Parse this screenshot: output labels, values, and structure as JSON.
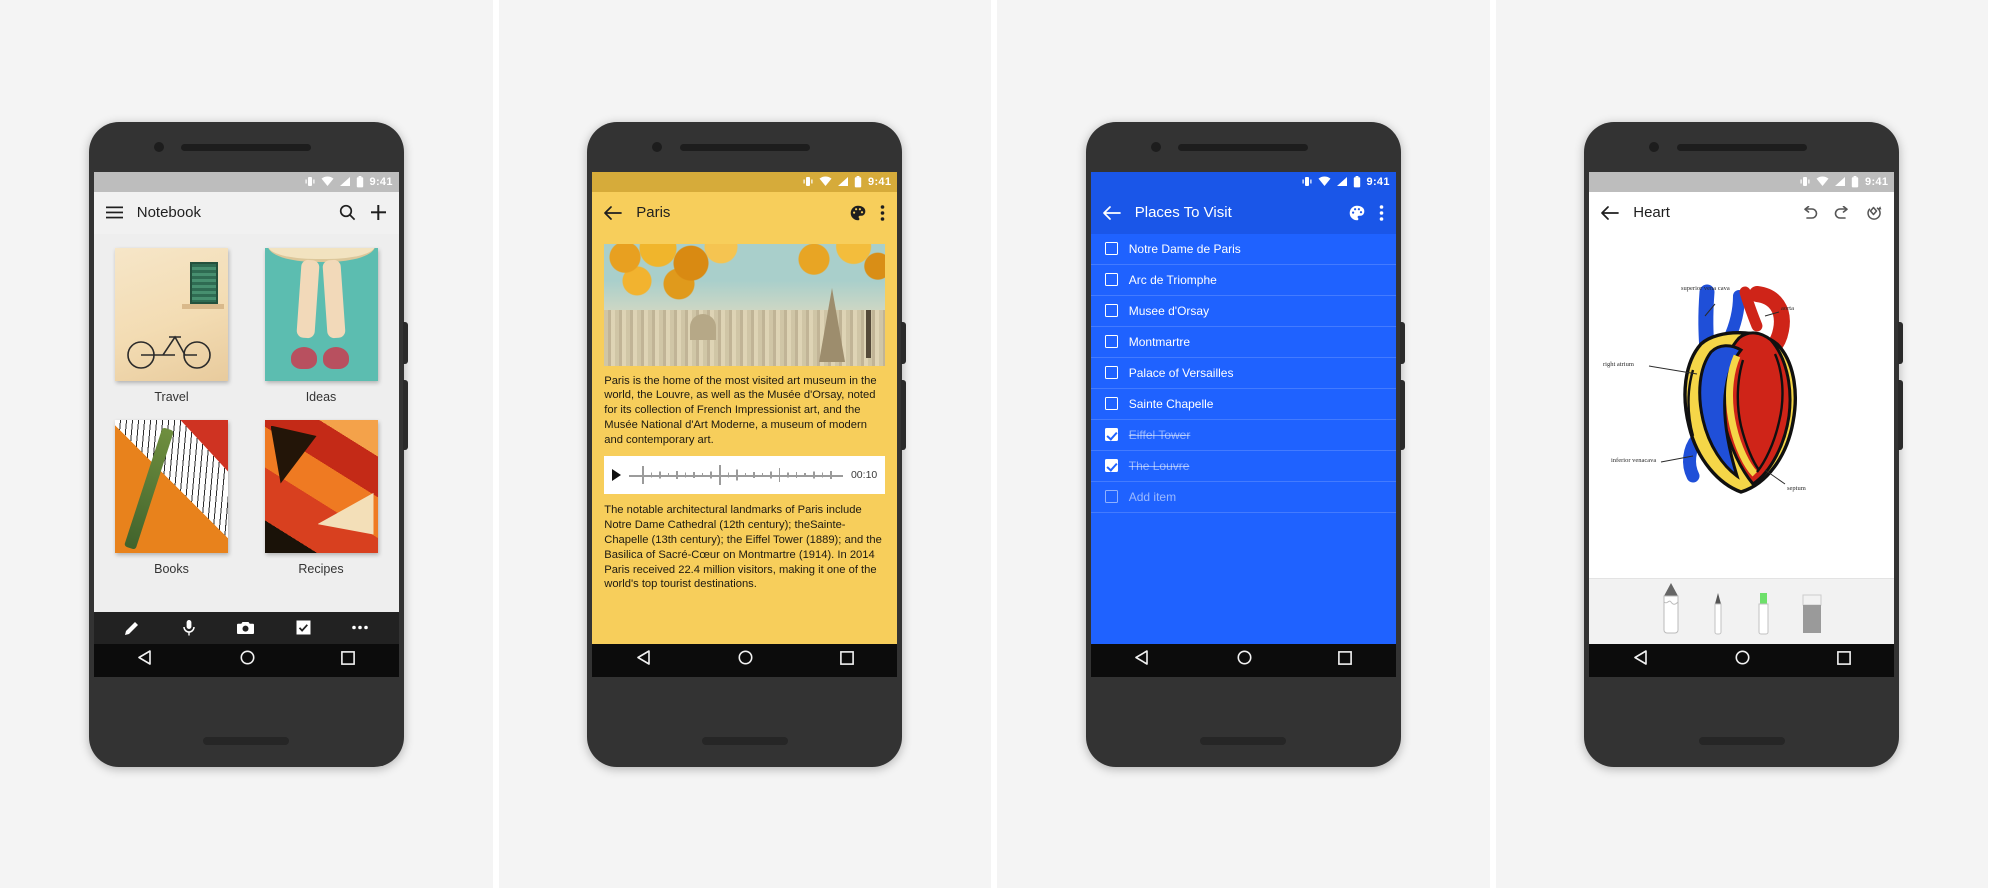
{
  "status_bar": {
    "time": "9:41",
    "icons": [
      "vibrate-icon",
      "wifi-icon",
      "signal-icon",
      "battery-icon"
    ]
  },
  "phones": [
    {
      "id": "notebook",
      "app_bar": {
        "menu_icon": "hamburger-menu-icon",
        "title": "Notebook",
        "actions": [
          "search-icon",
          "add-icon"
        ]
      },
      "notes": [
        {
          "label": "Travel",
          "thumb": "watercolor-bicycle-window"
        },
        {
          "label": "Ideas",
          "thumb": "ballet-shoes-teal"
        },
        {
          "label": "Books",
          "thumb": "orange-pattern-pen"
        },
        {
          "label": "Recipes",
          "thumb": "red-abstract-collage"
        }
      ],
      "bottom_toolbar": [
        "pen-icon",
        "microphone-icon",
        "camera-icon",
        "checklist-icon",
        "overflow-icon"
      ],
      "nav_bar": [
        "back-nav-icon",
        "home-nav-icon",
        "recents-nav-icon"
      ]
    },
    {
      "id": "paris-note",
      "app_bar": {
        "back_icon": "back-arrow-icon",
        "title": "Paris",
        "actions": [
          "palette-icon",
          "overflow-icon"
        ]
      },
      "photo_alt": "eiffel-tower-autumn-leaves-photo",
      "paragraphs": [
        "Paris is the home of the most visited art museum in the world, the Louvre, as well as the Musée d'Orsay, noted for its collection of French Impressionist art, and the Musée National d'Art Moderne, a museum of modern and contemporary art.",
        "The notable architectural landmarks of Paris include Notre Dame Cathedral (12th century); theSainte-Chapelle (13th century); the Eiffel Tower (1889); and the Basilica of Sacré-Cœur on Montmartre (1914). In 2014 Paris received 22.4 million visitors, making it one of the world's top tourist destinations."
      ],
      "audio": {
        "play_icon": "play-icon",
        "duration": "00:10"
      },
      "nav_bar": [
        "back-nav-icon",
        "home-nav-icon",
        "recents-nav-icon"
      ]
    },
    {
      "id": "places-to-visit",
      "app_bar": {
        "back_icon": "back-arrow-icon",
        "title": "Places To Visit",
        "actions": [
          "palette-icon",
          "overflow-icon"
        ]
      },
      "items": [
        {
          "label": "Notre Dame de Paris",
          "checked": false
        },
        {
          "label": "Arc de Triomphe",
          "checked": false
        },
        {
          "label": "Musee d'Orsay",
          "checked": false
        },
        {
          "label": "Montmartre",
          "checked": false
        },
        {
          "label": "Palace of Versailles",
          "checked": false
        },
        {
          "label": "Sainte Chapelle",
          "checked": false
        },
        {
          "label": "Eiffel Tower",
          "checked": true
        },
        {
          "label": "The Louvre",
          "checked": true
        }
      ],
      "add_item_label": "Add item",
      "nav_bar": [
        "back-nav-icon",
        "home-nav-icon",
        "recents-nav-icon"
      ]
    },
    {
      "id": "heart-drawing",
      "app_bar": {
        "back_icon": "back-arrow-icon",
        "title": "Heart",
        "actions": [
          "undo-icon",
          "redo-icon",
          "shape-refine-icon"
        ]
      },
      "drawing_labels": [
        "superior vena cava",
        "aorta",
        "right atrium",
        "inferior venacava",
        "septum"
      ],
      "tools": [
        "pencil-tool",
        "pen-tool",
        "highlighter-tool",
        "eraser-tool"
      ],
      "nav_bar": [
        "back-nav-icon",
        "home-nav-icon",
        "recents-nav-icon"
      ]
    }
  ],
  "colors": {
    "amber": "#f7ce5b",
    "blue": "#1f62ff",
    "blue_dark": "#1a56e8",
    "status_light": "#bdbdbd",
    "nav_black": "#0c0c0c",
    "toolbar_black": "#222222"
  }
}
